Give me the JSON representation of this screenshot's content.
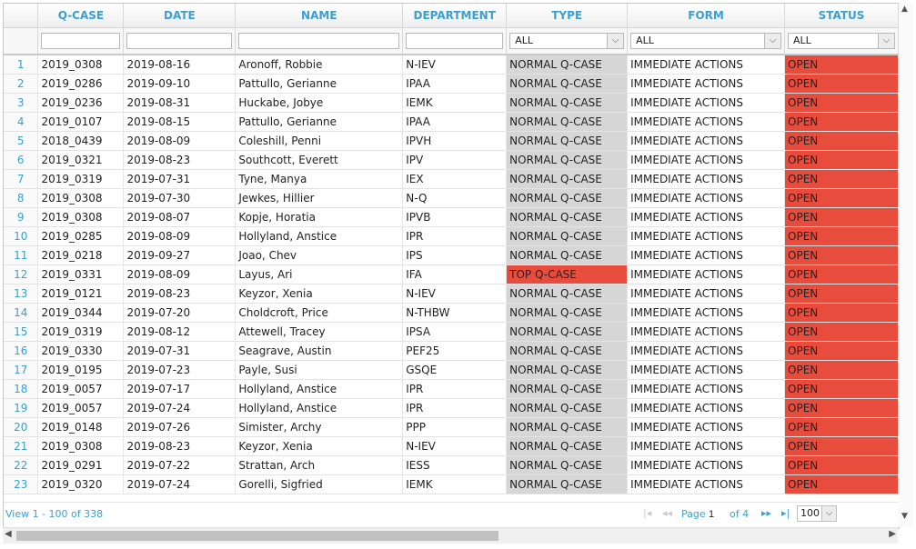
{
  "columns": [
    "Q-CASE",
    "DATE",
    "NAME",
    "DEPARTMENT",
    "TYPE",
    "FORM",
    "STATUS"
  ],
  "filters": {
    "type_selected": "ALL",
    "form_selected": "ALL",
    "status_selected": "ALL",
    "dropdown_arrow": "chevron-down-icon"
  },
  "rows": [
    {
      "n": "1",
      "qcase": "2019_0308",
      "date": "2019-08-16",
      "name": "Aronoff, Robbie",
      "dept": "N-IEV",
      "type": "NORMAL Q-CASE",
      "form": "IMMEDIATE ACTIONS",
      "status": "OPEN"
    },
    {
      "n": "2",
      "qcase": "2019_0286",
      "date": "2019-09-10",
      "name": "Pattullo, Gerianne",
      "dept": "IPAA",
      "type": "NORMAL Q-CASE",
      "form": "IMMEDIATE ACTIONS",
      "status": "OPEN"
    },
    {
      "n": "3",
      "qcase": "2019_0236",
      "date": "2019-08-31",
      "name": "Huckabe, Jobye",
      "dept": "IEMK",
      "type": "NORMAL Q-CASE",
      "form": "IMMEDIATE ACTIONS",
      "status": "OPEN"
    },
    {
      "n": "4",
      "qcase": "2019_0107",
      "date": "2019-08-15",
      "name": "Pattullo, Gerianne",
      "dept": "IPAA",
      "type": "NORMAL Q-CASE",
      "form": "IMMEDIATE ACTIONS",
      "status": "OPEN"
    },
    {
      "n": "5",
      "qcase": "2018_0439",
      "date": "2019-08-09",
      "name": "Coleshill, Penni",
      "dept": "IPVH",
      "type": "NORMAL Q-CASE",
      "form": "IMMEDIATE ACTIONS",
      "status": "OPEN"
    },
    {
      "n": "6",
      "qcase": "2019_0321",
      "date": "2019-08-23",
      "name": "Southcott, Everett",
      "dept": "IPV",
      "type": "NORMAL Q-CASE",
      "form": "IMMEDIATE ACTIONS",
      "status": "OPEN"
    },
    {
      "n": "7",
      "qcase": "2019_0319",
      "date": "2019-07-31",
      "name": "Tyne, Manya",
      "dept": "IEX",
      "type": "NORMAL Q-CASE",
      "form": "IMMEDIATE ACTIONS",
      "status": "OPEN"
    },
    {
      "n": "8",
      "qcase": "2019_0308",
      "date": "2019-07-30",
      "name": "Jewkes, Hillier",
      "dept": "N-Q",
      "type": "NORMAL Q-CASE",
      "form": "IMMEDIATE ACTIONS",
      "status": "OPEN"
    },
    {
      "n": "9",
      "qcase": "2019_0308",
      "date": "2019-08-07",
      "name": "Kopje, Horatia",
      "dept": "IPVB",
      "type": "NORMAL Q-CASE",
      "form": "IMMEDIATE ACTIONS",
      "status": "OPEN"
    },
    {
      "n": "10",
      "qcase": "2019_0285",
      "date": "2019-08-09",
      "name": "Hollyland, Anstice",
      "dept": "IPR",
      "type": "NORMAL Q-CASE",
      "form": "IMMEDIATE ACTIONS",
      "status": "OPEN"
    },
    {
      "n": "11",
      "qcase": "2019_0218",
      "date": "2019-09-27",
      "name": "Joao, Chev",
      "dept": "IPS",
      "type": "NORMAL Q-CASE",
      "form": "IMMEDIATE ACTIONS",
      "status": "OPEN"
    },
    {
      "n": "12",
      "qcase": "2019_0331",
      "date": "2019-08-09",
      "name": "Layus, Ari",
      "dept": "IFA",
      "type": "TOP Q-CASE",
      "form": "IMMEDIATE ACTIONS",
      "status": "OPEN"
    },
    {
      "n": "13",
      "qcase": "2019_0121",
      "date": "2019-08-23",
      "name": "Keyzor, Xenia",
      "dept": "N-IEV",
      "type": "NORMAL Q-CASE",
      "form": "IMMEDIATE ACTIONS",
      "status": "OPEN"
    },
    {
      "n": "14",
      "qcase": "2019_0344",
      "date": "2019-07-20",
      "name": "Choldcroft, Price",
      "dept": "N-THBW",
      "type": "NORMAL Q-CASE",
      "form": "IMMEDIATE ACTIONS",
      "status": "OPEN"
    },
    {
      "n": "15",
      "qcase": "2019_0319",
      "date": "2019-08-12",
      "name": "Attewell, Tracey",
      "dept": "IPSA",
      "type": "NORMAL Q-CASE",
      "form": "IMMEDIATE ACTIONS",
      "status": "OPEN"
    },
    {
      "n": "16",
      "qcase": "2019_0330",
      "date": "2019-07-31",
      "name": "Seagrave, Austin",
      "dept": "PEF25",
      "type": "NORMAL Q-CASE",
      "form": "IMMEDIATE ACTIONS",
      "status": "OPEN"
    },
    {
      "n": "17",
      "qcase": "2019_0195",
      "date": "2019-07-23",
      "name": "Payle, Susi",
      "dept": "GSQE",
      "type": "NORMAL Q-CASE",
      "form": "IMMEDIATE ACTIONS",
      "status": "OPEN"
    },
    {
      "n": "18",
      "qcase": "2019_0057",
      "date": "2019-07-17",
      "name": "Hollyland, Anstice",
      "dept": "IPR",
      "type": "NORMAL Q-CASE",
      "form": "IMMEDIATE ACTIONS",
      "status": "OPEN"
    },
    {
      "n": "19",
      "qcase": "2019_0057",
      "date": "2019-07-24",
      "name": "Hollyland, Anstice",
      "dept": "IPR",
      "type": "NORMAL Q-CASE",
      "form": "IMMEDIATE ACTIONS",
      "status": "OPEN"
    },
    {
      "n": "20",
      "qcase": "2019_0148",
      "date": "2019-07-26",
      "name": "Simister, Archy",
      "dept": "PPP",
      "type": "NORMAL Q-CASE",
      "form": "IMMEDIATE ACTIONS",
      "status": "OPEN"
    },
    {
      "n": "21",
      "qcase": "2019_0308",
      "date": "2019-08-23",
      "name": "Keyzor, Xenia",
      "dept": "N-IEV",
      "type": "NORMAL Q-CASE",
      "form": "IMMEDIATE ACTIONS",
      "status": "OPEN"
    },
    {
      "n": "22",
      "qcase": "2019_0291",
      "date": "2019-07-22",
      "name": "Strattan, Arch",
      "dept": "IESS",
      "type": "NORMAL Q-CASE",
      "form": "IMMEDIATE ACTIONS",
      "status": "OPEN"
    },
    {
      "n": "23",
      "qcase": "2019_0320",
      "date": "2019-07-24",
      "name": "Gorelli, Sigfried",
      "dept": "IEMK",
      "type": "NORMAL Q-CASE",
      "form": "IMMEDIATE ACTIONS",
      "status": "OPEN"
    }
  ],
  "pager": {
    "info": "View 1 - 100 of 338",
    "page_label": "Page",
    "page_value": "1",
    "of_label": "of 4",
    "rows_per_page": "100",
    "first_icon": "first-page-icon",
    "prev_icon": "prev-page-icon",
    "next_icon": "next-page-icon",
    "last_icon": "last-page-icon"
  },
  "colors": {
    "header_text": "#3a9fd6",
    "status_open": "#e84c3d",
    "type_top": "#e84c3d",
    "type_normal": "#d6d6d6"
  }
}
